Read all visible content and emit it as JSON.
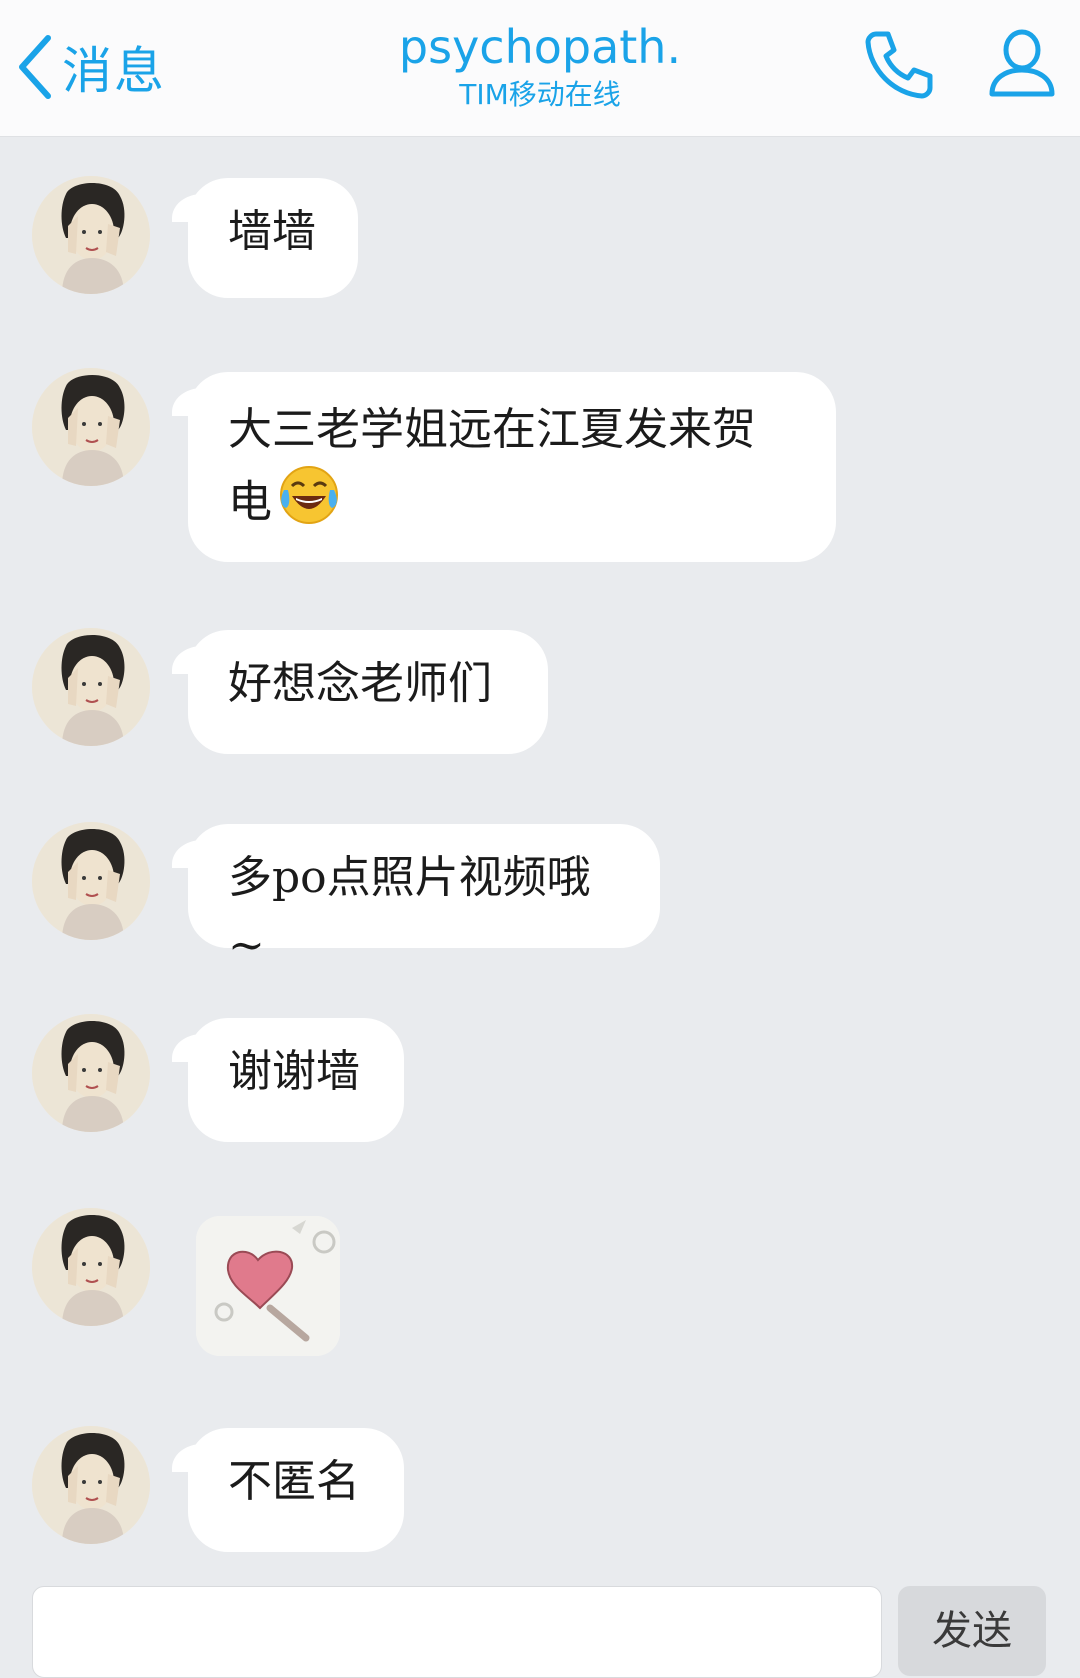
{
  "header": {
    "back_label": "消息",
    "contact_name": "psychopath.",
    "contact_status": "TIM移动在线",
    "call_icon": "phone-icon",
    "profile_icon": "person-icon",
    "accent_color": "#1aa3e8"
  },
  "messages": [
    {
      "type": "text",
      "text": "墙墙"
    },
    {
      "type": "text",
      "text": "大三老学姐远在江夏发来贺电",
      "emoji": "face-with-tears-of-joy"
    },
    {
      "type": "text",
      "text": "好想念老师们"
    },
    {
      "type": "text",
      "text": "多po点照片视频哦~"
    },
    {
      "type": "text",
      "text": "谢谢墙"
    },
    {
      "type": "sticker",
      "sticker": "heart-wand-sticker"
    },
    {
      "type": "text",
      "text": "不匿名"
    }
  ],
  "input": {
    "placeholder": "",
    "send_label": "发送"
  }
}
